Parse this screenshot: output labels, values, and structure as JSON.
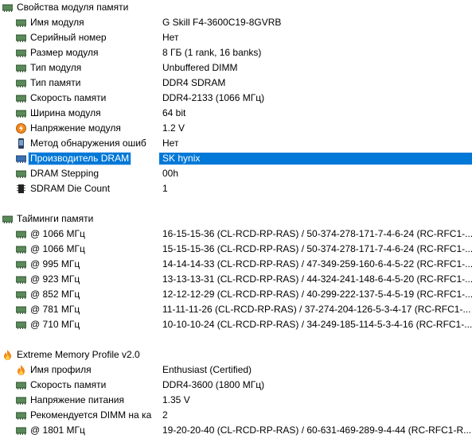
{
  "sections": {
    "module": {
      "title": "Свойства модуля памяти",
      "rows": [
        {
          "label": "Имя модуля",
          "value": "G Skill F4-3600C19-8GVRB",
          "icon": "ram-icon"
        },
        {
          "label": "Серийный номер",
          "value": "Нет",
          "icon": "ram-icon"
        },
        {
          "label": "Размер модуля",
          "value": "8 ГБ (1 rank, 16 banks)",
          "icon": "ram-icon"
        },
        {
          "label": "Тип модуля",
          "value": "Unbuffered DIMM",
          "icon": "ram-icon"
        },
        {
          "label": "Тип памяти",
          "value": "DDR4 SDRAM",
          "icon": "ram-icon"
        },
        {
          "label": "Скорость памяти",
          "value": "DDR4-2133 (1066 МГц)",
          "icon": "ram-icon"
        },
        {
          "label": "Ширина модуля",
          "value": "64 bit",
          "icon": "ram-icon"
        },
        {
          "label": "Напряжение модуля",
          "value": "1.2 V",
          "icon": "voltage-icon"
        },
        {
          "label": "Метод обнаружения ошиб",
          "value": "Нет",
          "icon": "device-icon"
        },
        {
          "label": "Производитель DRAM",
          "value": "SK hynix",
          "icon": "ram-blue-icon",
          "selected": true
        },
        {
          "label": "DRAM Stepping",
          "value": "00h",
          "icon": "ram-icon"
        },
        {
          "label": "SDRAM Die Count",
          "value": "1",
          "icon": "chip-icon"
        }
      ]
    },
    "timings": {
      "title": "Тайминги памяти",
      "rows": [
        {
          "label": "@ 1066 МГц",
          "value": "16-15-15-36  (CL-RCD-RP-RAS) / 50-374-278-171-7-4-6-24  (RC-RFC1-..."
        },
        {
          "label": "@ 1066 МГц",
          "value": "15-15-15-36  (CL-RCD-RP-RAS) / 50-374-278-171-7-4-6-24  (RC-RFC1-..."
        },
        {
          "label": "@ 995 МГц",
          "value": "14-14-14-33  (CL-RCD-RP-RAS) / 47-349-259-160-6-4-5-22  (RC-RFC1-..."
        },
        {
          "label": "@ 923 МГц",
          "value": "13-13-13-31  (CL-RCD-RP-RAS) / 44-324-241-148-6-4-5-20  (RC-RFC1-..."
        },
        {
          "label": "@ 852 МГц",
          "value": "12-12-12-29  (CL-RCD-RP-RAS) / 40-299-222-137-5-4-5-19  (RC-RFC1-..."
        },
        {
          "label": "@ 781 МГц",
          "value": "11-11-11-26  (CL-RCD-RP-RAS) / 37-274-204-126-5-3-4-17  (RC-RFC1-..."
        },
        {
          "label": "@ 710 МГц",
          "value": "10-10-10-24  (CL-RCD-RP-RAS) / 34-249-185-114-5-3-4-16  (RC-RFC1-..."
        }
      ]
    },
    "xmp": {
      "title": "Extreme Memory Profile v2.0",
      "rows": [
        {
          "label": "Имя профиля",
          "value": "Enthusiast (Certified)",
          "icon": "flame-icon"
        },
        {
          "label": "Скорость памяти",
          "value": "DDR4-3600 (1800 МГц)",
          "icon": "ram-icon"
        },
        {
          "label": "Напряжение питания",
          "value": "1.35 V",
          "icon": "ram-icon"
        },
        {
          "label": "Рекомендуется DIMM на ка",
          "value": "2",
          "icon": "ram-icon"
        },
        {
          "label": "@ 1801 МГц",
          "value": "19-20-20-40  (CL-RCD-RP-RAS) / 60-631-469-289-9-4-44  (RC-RFC1-R..."
        }
      ]
    }
  },
  "colors": {
    "selection": "#0078d7",
    "ram": "#3f6e3f",
    "flame": "#e07a10"
  }
}
